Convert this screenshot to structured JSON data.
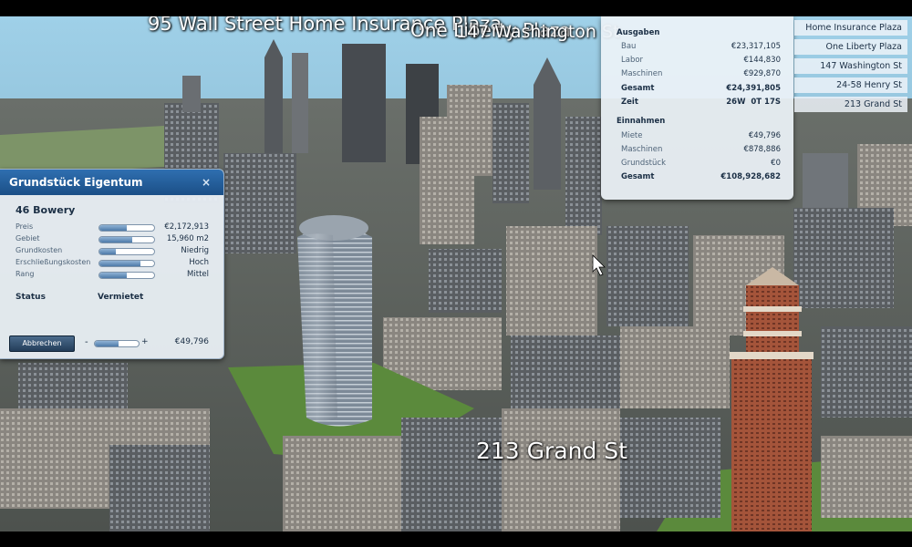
{
  "floating_labels": {
    "wall_street": "95 Wall Street",
    "home_insurance": "Home Insurance Plaza",
    "one_liberty": "One Liberty Plaza",
    "washington": "147 Washington St",
    "grand": "213 Grand St"
  },
  "property_panel": {
    "title": "Grundstück Eigentum",
    "close": "×",
    "name": "46 Bowery",
    "rows": [
      {
        "label": "Preis",
        "value": "€2,172,913",
        "level": 0.5
      },
      {
        "label": "Gebiet",
        "value": "15,960 m2",
        "level": 0.6
      },
      {
        "label": "Grundkosten",
        "value": "Niedrig",
        "level": 0.3
      },
      {
        "label": "Erschließungskosten",
        "value": "Hoch",
        "level": 0.75
      },
      {
        "label": "Rang",
        "value": "Mittel",
        "level": 0.5
      }
    ],
    "status_label": "Status",
    "status_value": "Vermietet",
    "cancel_button": "Abbrechen",
    "minus": "-",
    "plus": "+",
    "rent_level": 0.55,
    "rent_price": "€49,796"
  },
  "finance_panel": {
    "expenses_heading": "Ausgaben",
    "expenses": [
      {
        "label": "Bau",
        "value": "€23,317,105"
      },
      {
        "label": "Labor",
        "value": "€144,830"
      },
      {
        "label": "Maschinen",
        "value": "€929,870"
      }
    ],
    "expenses_total_label": "Gesamt",
    "expenses_total": "€24,391,805",
    "time_label": "Zeit",
    "time_value": "26W  0T 17S",
    "income_heading": "Einnahmen",
    "income": [
      {
        "label": "Miete",
        "value": "€49,796"
      },
      {
        "label": "Maschinen",
        "value": "€878,886"
      },
      {
        "label": "Grundstück",
        "value": "€0"
      }
    ],
    "income_total_label": "Gesamt",
    "income_total": "€108,928,682"
  },
  "building_list": [
    "Home Insurance Plaza",
    "One Liberty Plaza",
    "147 Washington St",
    "24-58 Henry St",
    "213 Grand St"
  ],
  "colors": {
    "panel_header": "#1b4f87",
    "panel_bg": "#ecf2f8",
    "sky": "#8fc3e0",
    "grass": "#5b8a3c",
    "tower_brick": "#a4543a"
  }
}
